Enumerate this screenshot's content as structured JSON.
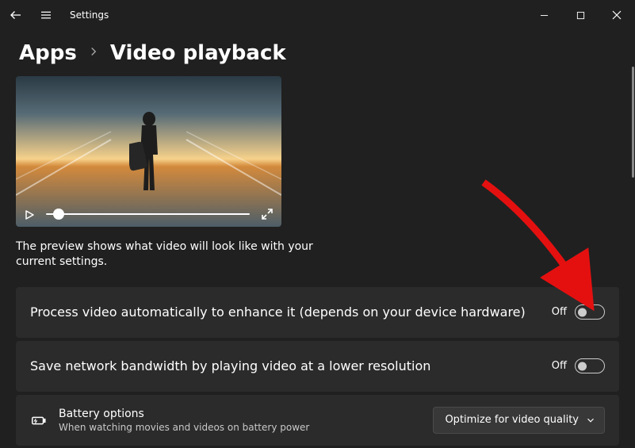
{
  "titlebar": {
    "title": "Settings"
  },
  "breadcrumb": {
    "parent": "Apps",
    "page": "Video playback"
  },
  "preview": {
    "description": "The preview shows what video will look like with your current settings."
  },
  "rows": {
    "processVideo": {
      "title": "Process video automatically to enhance it (depends on your device hardware)",
      "toggle": "Off"
    },
    "saveBandwidth": {
      "title": "Save network bandwidth by playing video at a lower resolution",
      "toggle": "Off"
    },
    "battery": {
      "title": "Battery options",
      "subtitle": "When watching movies and videos on battery power",
      "dropdownValue": "Optimize for video quality"
    }
  }
}
